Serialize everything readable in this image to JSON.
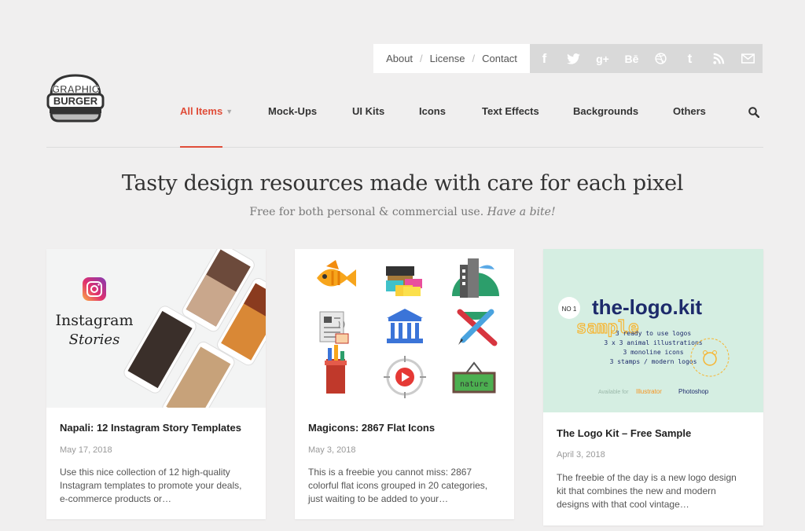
{
  "top_links": [
    "About",
    "License",
    "Contact"
  ],
  "social": [
    {
      "name": "facebook-icon",
      "glyph": "f"
    },
    {
      "name": "twitter-icon",
      "glyph": ""
    },
    {
      "name": "google-plus-icon",
      "glyph": "g+"
    },
    {
      "name": "behance-icon",
      "glyph": "Bē"
    },
    {
      "name": "dribbble-icon",
      "glyph": ""
    },
    {
      "name": "tumblr-icon",
      "glyph": "t"
    },
    {
      "name": "rss-icon",
      "glyph": ""
    },
    {
      "name": "email-icon",
      "glyph": ""
    }
  ],
  "logo": {
    "line1": "GRAPHIC",
    "line2": "BURGER"
  },
  "nav": {
    "items": [
      "All Items",
      "Mock-Ups",
      "UI Kits",
      "Icons",
      "Text Effects",
      "Backgrounds",
      "Others"
    ],
    "active_color": "#e04d39"
  },
  "hero": {
    "title": "Tasty design resources made with care for each pixel",
    "subtitle": "Free for both personal & commercial use.",
    "subtitle_em": "Have a bite!"
  },
  "cards": [
    {
      "title": "Napali: 12 Instagram Story Templates",
      "date": "May 17, 2018",
      "desc": "Use this nice collection of 12 high-quality Instagram templates to promote your deals, e-commerce products or…",
      "image_text": {
        "line1": "Instagram",
        "line2": "Stories"
      }
    },
    {
      "title": "Magicons: 2867 Flat Icons",
      "date": "May 3, 2018",
      "desc": "This is a freebie you cannot miss: 2867 colorful flat icons grouped in 20 categories, just waiting to be added to your…",
      "image_text": {
        "sign": "nature"
      }
    },
    {
      "title": "The Logo Kit – Free Sample",
      "date": "April 3, 2018",
      "desc": "The freebie of the day is a new logo design kit that combines the new and modern designs with that cool vintage…",
      "image_text": {
        "badge": "NO 1",
        "brand": "the-logo.kit",
        "sample": "sample",
        "list": [
          "3 ready to use logos",
          "3 x 3 animal illustrations",
          "3 monoline icons",
          "3 stamps / modern logos"
        ],
        "circle": "EASY TO CUSTOMIZE",
        "avail": "Available for",
        "app1": "Illustrator",
        "app2": "Photoshop"
      }
    }
  ]
}
